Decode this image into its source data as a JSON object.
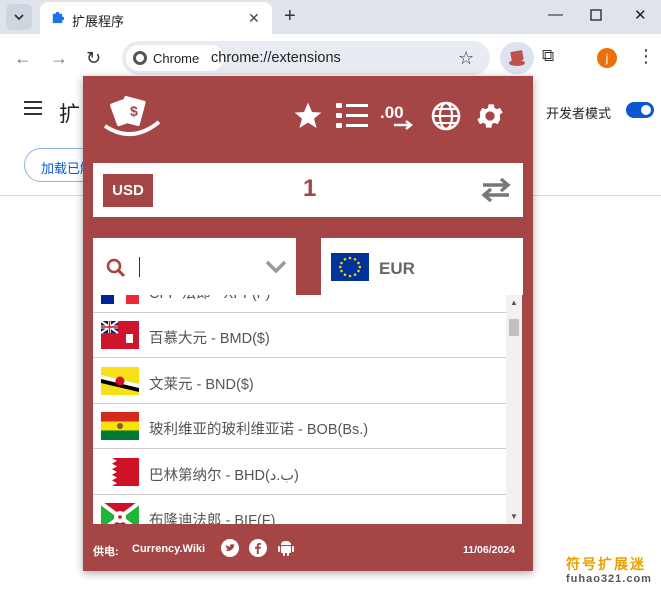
{
  "browser": {
    "tab_title": "扩展程序",
    "chip_label": "Chrome",
    "url": "chrome://extensions",
    "profile_initial": "j"
  },
  "page": {
    "title": "扩",
    "developer_mode_label": "开发者模式",
    "load_button_label": "加载已解压的扩展程序"
  },
  "popup": {
    "source_currency": "USD",
    "amount": "1",
    "search_value": "",
    "target_currency": "EUR",
    "currency_list": [
      {
        "label": "CFP 法郎 - XPF(F)",
        "flag": "flag-fr-icon"
      },
      {
        "label": "百慕大元 - BMD($)",
        "flag": "flag-bermuda-icon"
      },
      {
        "label": "文莱元 - BND($)",
        "flag": "flag-brunei-icon"
      },
      {
        "label": "玻利维亚的玻利维亚诺 - BOB(Bs.)",
        "flag": "flag-bolivia-icon"
      },
      {
        "label": "巴林第纳尔 - BHD(ب.د)",
        "flag": "flag-bahrain-icon"
      },
      {
        "label": "布隆迪法郎 - BIF(F)",
        "flag": "flag-burundi-icon"
      }
    ],
    "footer": {
      "powered_by_label": "供电:",
      "site": "Currency.Wiki",
      "date": "11/06/2024"
    }
  },
  "watermark": {
    "cn": "符号扩展迷",
    "en": "fuhao321.com"
  },
  "colors": {
    "brand": "#a54545",
    "accent_blue": "#0b57d0"
  }
}
